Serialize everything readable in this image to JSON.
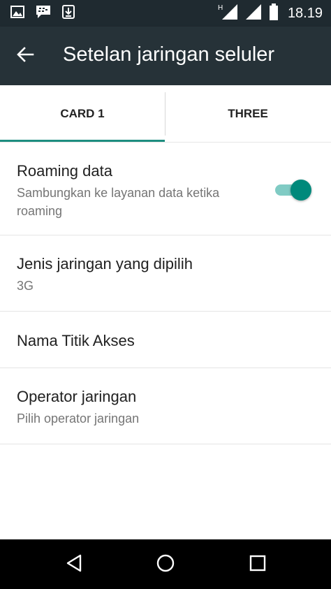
{
  "status_bar": {
    "time": "18.19",
    "network_type": "H",
    "icons": [
      "image-icon",
      "bbm-icon",
      "download-icon",
      "signal-icon",
      "signal-icon",
      "battery-icon"
    ]
  },
  "app_bar": {
    "title": "Setelan jaringan seluler",
    "back_icon": "arrow-back-icon"
  },
  "tabs": [
    {
      "label": "CARD 1",
      "selected": true
    },
    {
      "label": "THREE",
      "selected": false
    }
  ],
  "preferences": {
    "roaming": {
      "title": "Roaming data",
      "summary": "Sambungkan ke layanan data ketika roaming",
      "enabled": true
    },
    "network_type": {
      "title": "Jenis jaringan yang dipilih",
      "summary": "3G"
    },
    "apn": {
      "title": "Nama Titik Akses"
    },
    "operator": {
      "title": "Operator jaringan",
      "summary": "Pilih operator jaringan"
    }
  },
  "colors": {
    "status_bar": "#1f2a30",
    "app_bar": "#263238",
    "accent": "#00897b",
    "accent_light": "#80cbc4",
    "tab_indicator": "#1e8e80",
    "nav_bar": "#000000"
  },
  "nav_bar": {
    "icons": [
      "back-triangle-icon",
      "home-circle-icon",
      "recents-square-icon"
    ]
  }
}
